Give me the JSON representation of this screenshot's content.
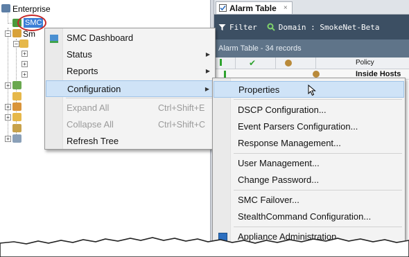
{
  "tree": {
    "root_label": "Enterprise",
    "selected_label": "SMC",
    "partial_label": "Sm"
  },
  "tab": {
    "title": "Alarm Table",
    "close": "×"
  },
  "toolbar": {
    "filter_label": "Filter",
    "domain_label": "Domain : SmokeNet-Beta"
  },
  "table": {
    "record_text": "Alarm Table - 34 records",
    "policy_header": "Policy",
    "first_row_policy": "Inside Hosts"
  },
  "context_menu": {
    "items": [
      {
        "label": "SMC Dashboard",
        "shortcut": "",
        "submenu": false,
        "disabled": false
      },
      {
        "label": "Status",
        "shortcut": "",
        "submenu": true,
        "disabled": false
      },
      {
        "label": "Reports",
        "shortcut": "",
        "submenu": true,
        "disabled": false
      },
      {
        "label": "Configuration",
        "shortcut": "",
        "submenu": true,
        "disabled": false
      },
      {
        "label": "Expand All",
        "shortcut": "Ctrl+Shift+E",
        "submenu": false,
        "disabled": true
      },
      {
        "label": "Collapse All",
        "shortcut": "Ctrl+Shift+C",
        "submenu": false,
        "disabled": true
      },
      {
        "label": "Refresh Tree",
        "shortcut": "",
        "submenu": false,
        "disabled": false
      }
    ]
  },
  "submenu": {
    "items": [
      {
        "label": "Properties"
      },
      {
        "label": "DSCP Configuration..."
      },
      {
        "label": "Event Parsers Configuration..."
      },
      {
        "label": "Response Management..."
      },
      {
        "label": "User Management..."
      },
      {
        "label": "Change Password..."
      },
      {
        "label": "SMC Failover..."
      },
      {
        "label": "StealthCommand Configuration..."
      },
      {
        "label": "Appliance Administration"
      }
    ]
  }
}
